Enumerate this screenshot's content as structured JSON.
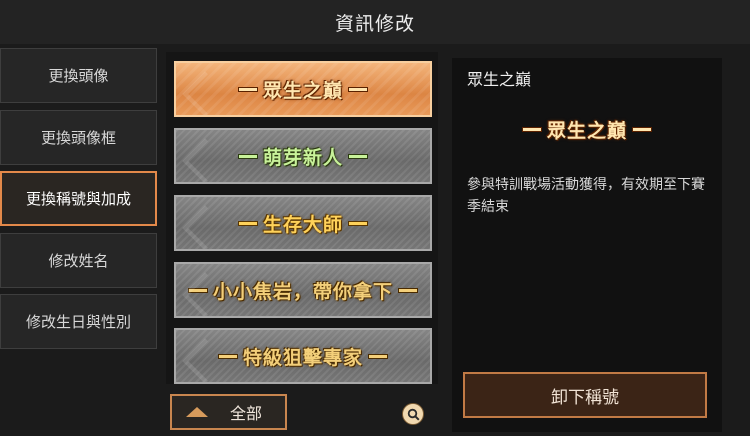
{
  "header": {
    "title": "資訊修改"
  },
  "nav": {
    "items": [
      {
        "label": "更換頭像"
      },
      {
        "label": "更換頭像框"
      },
      {
        "label": "更換稱號與加成"
      },
      {
        "label": "修改姓名"
      },
      {
        "label": "修改生日與性別"
      }
    ],
    "active_index": 2
  },
  "titles": {
    "items": [
      {
        "label": "眾生之巔",
        "style": "orange",
        "selected": true
      },
      {
        "label": "萌芽新人",
        "style": "green",
        "selected": false
      },
      {
        "label": "生存大師",
        "style": "yellow",
        "selected": false
      },
      {
        "label": "小小焦岩，帶你拿下",
        "style": "gold",
        "selected": false
      },
      {
        "label": "特級狙擊專家",
        "style": "gold",
        "selected": false
      }
    ]
  },
  "filter": {
    "label": "全部"
  },
  "detail": {
    "title": "眾生之巔",
    "badge": "眾生之巔",
    "description": "參與特訓戰場活動獲得，有效期至下賽季結束",
    "unequip_label": "卸下稱號"
  },
  "colors": {
    "accent": "#e3894a",
    "panel_bg": "#111111",
    "selected_card": "#dc8543",
    "unselected_card": "#7b7b7b"
  },
  "icons": {
    "search": "search-icon",
    "filter": "triangle-up-icon"
  }
}
